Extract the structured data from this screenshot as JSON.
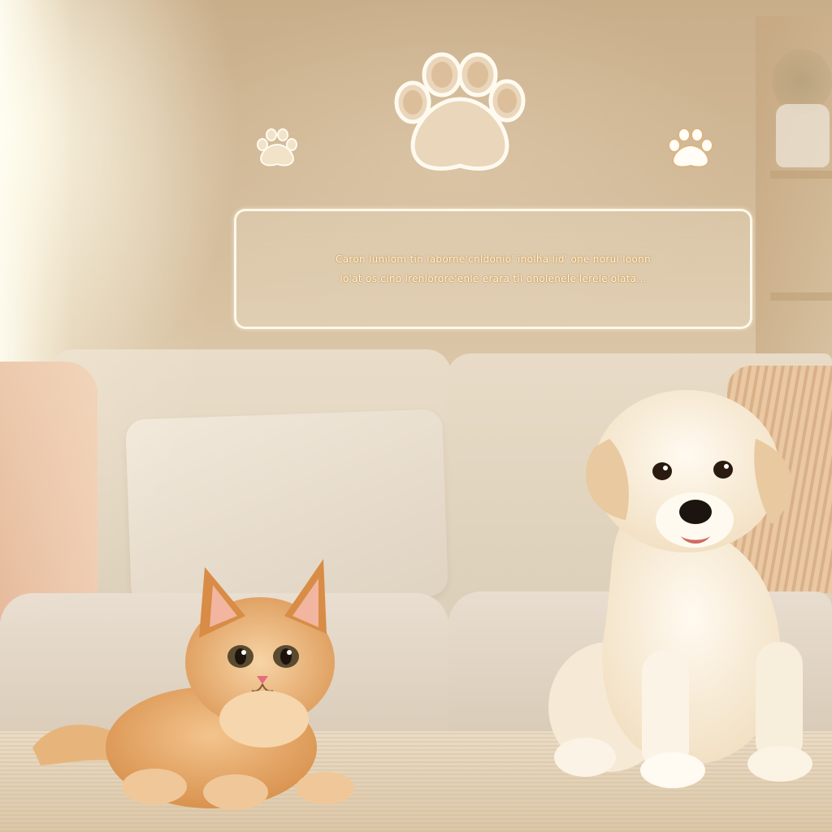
{
  "scene": {
    "description_icons": [
      "paw-icon",
      "paw-icon",
      "paw-icon"
    ]
  },
  "panel": {
    "line1": "Caron  lunilom  tin laborne'cnldonio'  inolha  lid'  one norul  loonn",
    "line2": "lo'at os  cino  lrenlorore'enle  erara  tll  onolenele'lerele'olata..."
  },
  "colors": {
    "paw_fill": "#e9d3b6",
    "paw_outline": "#fffaf0",
    "panel_border": "#fffcf0",
    "panel_text_glow": "#c98f3d"
  }
}
